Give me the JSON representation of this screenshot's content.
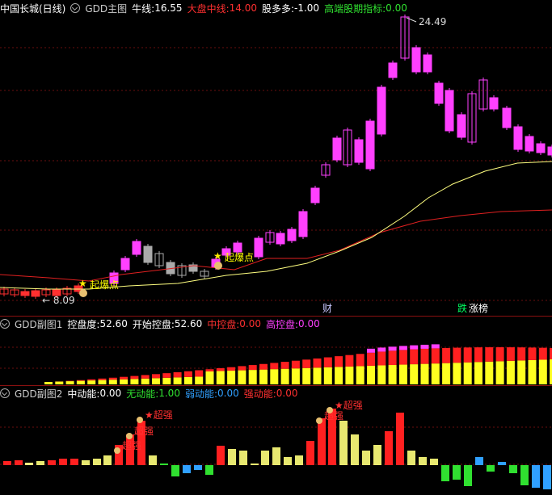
{
  "main": {
    "stock": "中国长城(日线)",
    "indicator": "GDD主图",
    "items": [
      {
        "label": "牛线:",
        "value": "16.55",
        "color": "#ffffff"
      },
      {
        "label": "大盘中线:",
        "value": "14.00",
        "color": "#ff3030"
      },
      {
        "label": "股多多:",
        "value": "-1.00",
        "color": "#ffffff"
      },
      {
        "label": "高端股期指标:",
        "value": "0.00",
        "color": "#30e030"
      }
    ],
    "high_label": "24.49",
    "low_label": "8.09",
    "signals": [
      "起爆点",
      "起爆点"
    ],
    "markers": [
      "财",
      "跌",
      "涨榜"
    ]
  },
  "sub1": {
    "indicator": "GDD副图1",
    "items": [
      {
        "label": "控盘度:",
        "value": "52.60",
        "color": "#ffffff"
      },
      {
        "label": "开始控盘:",
        "value": "52.60",
        "color": "#ffffff"
      },
      {
        "label": "中控盘:",
        "value": "0.00",
        "color": "#ff3030"
      },
      {
        "label": "高控盘:",
        "value": "0.00",
        "color": "#ff40ff"
      }
    ]
  },
  "sub2": {
    "indicator": "GDD副图2",
    "items": [
      {
        "label": "中动能:",
        "value": "0.00",
        "color": "#ffffff"
      },
      {
        "label": "无动能:",
        "value": "1.00",
        "color": "#30e030"
      },
      {
        "label": "弱动能:",
        "value": "0.00",
        "color": "#30a0ff"
      },
      {
        "label": "强动能:",
        "value": "0.00",
        "color": "#ff3030"
      }
    ],
    "signals": [
      "超强",
      "超强",
      "超强",
      "超强",
      "超强"
    ]
  }
}
